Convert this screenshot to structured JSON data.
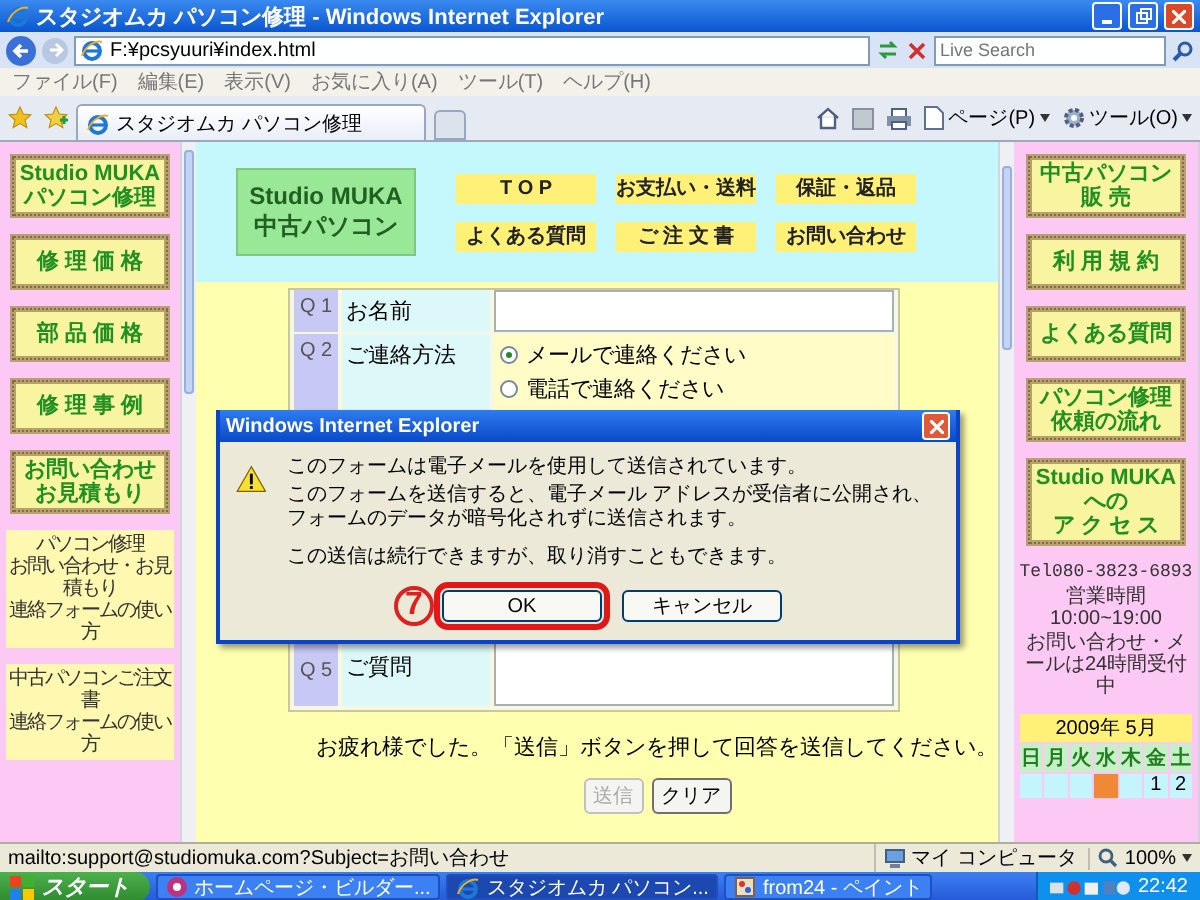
{
  "window": {
    "title": "スタジオムカ パソコン修理 - Windows Internet Explorer"
  },
  "address_bar": {
    "url": "F:¥pcsyuuri¥index.html",
    "search": {
      "placeholder": "Live Search"
    }
  },
  "menu": [
    "ファイル(F)",
    "編集(E)",
    "表示(V)",
    "お気に入り(A)",
    "ツール(T)",
    "ヘルプ(H)"
  ],
  "tabs": [
    {
      "label": "スタジオムカ パソコン修理",
      "selected": true
    }
  ],
  "toolbar": [
    "ページ(P)",
    "ツール(O)"
  ],
  "left_sidebar": {
    "buttons": [
      {
        "lines": [
          "Studio MUKA",
          "パソコン修理"
        ]
      },
      {
        "lines": [
          "修 理 価 格"
        ]
      },
      {
        "lines": [
          "部 品 価 格"
        ]
      },
      {
        "lines": [
          "修 理 事 例"
        ]
      },
      {
        "lines": [
          "お問い合わせ",
          "お見積もり"
        ]
      }
    ],
    "notes": [
      {
        "lines": [
          "パソコン修理",
          "お問い合わせ・お見積もり",
          "連絡フォームの使い方"
        ]
      },
      {
        "lines": [
          "中古パソコンご注文書",
          "連絡フォームの使い方"
        ]
      }
    ]
  },
  "header": {
    "logo": [
      "Studio MUKA",
      "中古パソコン"
    ],
    "nav": [
      "T O P",
      "お支払い・送料",
      "保証・返品",
      "よくある質問",
      "ご 注 文 書",
      "お問い合わせ"
    ]
  },
  "form": {
    "questions": [
      {
        "number": "Q 1",
        "label": "お名前",
        "kind": "text"
      },
      {
        "number": "Q 2",
        "label": "ご連絡方法",
        "kind": "radio",
        "options": [
          {
            "label": "メールで連絡ください",
            "selected": true
          },
          {
            "label": "電話で連絡ください",
            "selected": false
          }
        ]
      },
      {
        "number": "Q 5",
        "label": "ご質問",
        "kind": "textarea"
      }
    ],
    "instruction": "お疲れ様でした。「送信」ボタンを押して回答を送信してください。",
    "buttons": [
      {
        "label": "送信",
        "disabled": true
      },
      {
        "label": "クリア",
        "disabled": false
      }
    ]
  },
  "dialog": {
    "title": "Windows Internet Explorer",
    "messages": [
      "このフォームは電子メールを使用して送信されています。",
      "このフォームを送信すると、電子メール アドレスが受信者に公開され、フォームのデータが暗号化されずに送信されます。",
      "この送信は続行できますが、取り消すこともできます。"
    ],
    "buttons": [
      {
        "label": "OK",
        "highlighted": true
      },
      {
        "label": "キャンセル",
        "highlighted": false
      }
    ],
    "step_marker": "7"
  },
  "right_sidebar": {
    "buttons": [
      {
        "lines": [
          "中古パソコン",
          "販 売"
        ]
      },
      {
        "lines": [
          "利 用 規 約"
        ]
      },
      {
        "lines": [
          "よくある質問"
        ]
      },
      {
        "lines": [
          "パソコン修理",
          "依頼の流れ"
        ]
      },
      {
        "lines": [
          "Studio MUKA",
          "への",
          "ア ク セ ス"
        ]
      }
    ],
    "info": [
      "Tel080-3823-6893",
      "営業時間 10:00~19:00",
      "お問い合わせ・メールは24時間受付中"
    ],
    "calendar": {
      "title": "2009年 5月",
      "weekdays": [
        "日",
        "月",
        "火",
        "水",
        "木",
        "金",
        "土"
      ],
      "days": [
        {
          "highlighted": false
        },
        {
          "highlighted": false
        },
        {
          "highlighted": false
        },
        {
          "highlighted": true
        },
        {
          "highlighted": false
        },
        {
          "text": "1",
          "highlighted": false
        },
        {
          "text": "2",
          "highlighted": false
        }
      ]
    }
  },
  "status_bar": {
    "text": "mailto:support@studiomuka.com?Subject=お問い合わせ",
    "zone": "マイ コンピュータ",
    "zoom": "100%"
  },
  "taskbar": {
    "start": "スタート",
    "windows": [
      {
        "label": "ホームページ・ビルダー...",
        "selected": false
      },
      {
        "label": "スタジオムカ パソコン...",
        "selected": true
      },
      {
        "label": "from24 - ペイント",
        "selected": false
      }
    ],
    "clock": "22:42"
  }
}
